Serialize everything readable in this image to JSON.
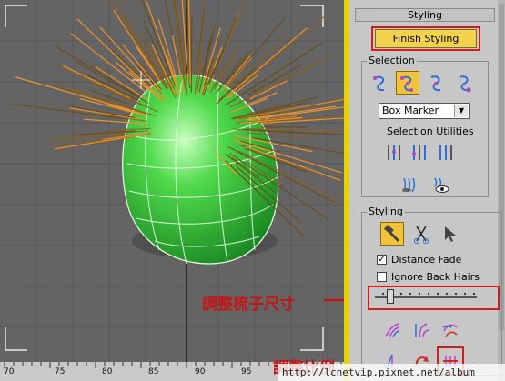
{
  "viewport": {
    "ruler_labels": [
      "70",
      "75",
      "80",
      "85",
      "90",
      "95"
    ],
    "annotation_arrow_label": "調整梳子尺寸",
    "annotation_bottom_label": "調整比例"
  },
  "panel": {
    "rollout_title": "Styling",
    "rollout_toggle": "−",
    "finish_button": "Finish Styling",
    "selection": {
      "label": "Selection",
      "dropdown_value": "Box Marker",
      "utilities_label": "Selection Utilities"
    },
    "styling": {
      "label": "Styling",
      "distance_fade": {
        "label": "Distance Fade",
        "checked": true
      },
      "ignore_back_hairs": {
        "label": "Ignore Back Hairs",
        "checked": false
      },
      "brush_size_fraction": 0.15
    }
  },
  "watermark": "http://lcnetvip.pixnet.net/album",
  "colors": {
    "accent_yellow": "#f5d24b",
    "highlight_red": "#d21d1d",
    "head_green": "#35c23c",
    "hair_orange": "#f0932a"
  }
}
